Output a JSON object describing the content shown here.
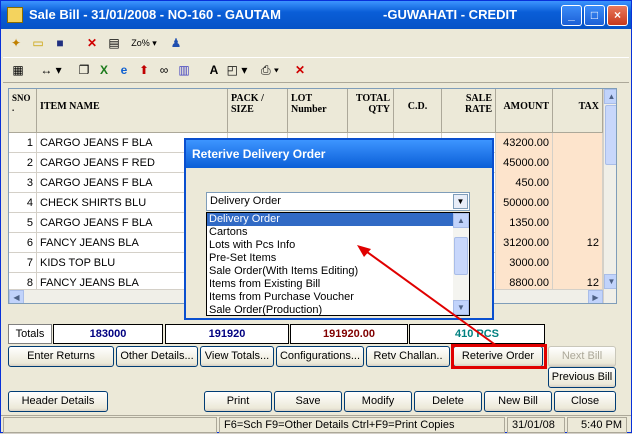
{
  "window": {
    "title": "Sale Bill - 31/01/2008 - NO-160 - GAUTAM",
    "title_right": "-GUWAHATI - CREDIT",
    "minimize": "_",
    "maximize": "□",
    "close": "×"
  },
  "toolbar1": {
    "zoom_label": "Zo%"
  },
  "grid": {
    "headers": [
      "SNO .",
      "ITEM NAME",
      "PACK / SIZE",
      "LOT Number",
      "TOTAL QTY",
      "C.D.",
      "SALE RATE",
      "AMOUNT",
      "TAX"
    ],
    "rows": [
      {
        "sno": "1",
        "item": "CARGO JEANS F BLA",
        "amount": "43200.00",
        "tax": ""
      },
      {
        "sno": "2",
        "item": "CARGO JEANS F RED",
        "amount": "45000.00",
        "tax": ""
      },
      {
        "sno": "3",
        "item": "CARGO JEANS F BLA",
        "amount": "450.00",
        "tax": ""
      },
      {
        "sno": "4",
        "item": "CHECK SHIRTS BLU",
        "amount": "50000.00",
        "tax": ""
      },
      {
        "sno": "5",
        "item": "CARGO JEANS F BLA",
        "amount": "1350.00",
        "tax": ""
      },
      {
        "sno": "6",
        "item": "FANCY JEANS BLA",
        "amount": "31200.00",
        "tax": "12"
      },
      {
        "sno": "7",
        "item": "KIDS TOP BLU",
        "amount": "3000.00",
        "tax": ""
      },
      {
        "sno": "8",
        "item": "FANCY JEANS BLA",
        "amount": "8800.00",
        "tax": "12"
      }
    ]
  },
  "totals": {
    "label": "Totals",
    "total1": "183000",
    "total2": "191920",
    "total3": "191920.00",
    "pcs": "410 PCS"
  },
  "buttons_row1": [
    "Enter Returns",
    "Other Details...",
    "View Totals...",
    "Configurations...",
    "Retv Challan..",
    "Reterive Order",
    "Next Bill"
  ],
  "buttons_row2": [
    "Previous Bill"
  ],
  "buttons_row3": [
    "Header Details",
    "Print",
    "Save",
    "Modify",
    "Delete",
    "New Bill",
    "Close"
  ],
  "status": {
    "shortcuts": "F6=Sch F9=Other Details Ctrl+F9=Print Copies",
    "date": "31/01/08",
    "time": "5:40 PM"
  },
  "dialog": {
    "title": "Reterive Delivery Order",
    "selected": "Delivery Order",
    "options": [
      "Delivery Order",
      "Cartons",
      "Lots with Pcs Info",
      "Pre-Set Items",
      "Sale Order(With Items Editing)",
      "Items from Existing Bill",
      "Items from Purchase Voucher",
      "Sale Order(Production)"
    ]
  },
  "colors": {
    "title_blue": "#0a5ed7",
    "highlight_red": "#e00000",
    "totals_blue": "#000080",
    "totals_red": "#800000",
    "pcs_teal": "#008080",
    "selection": "#316ac5"
  }
}
